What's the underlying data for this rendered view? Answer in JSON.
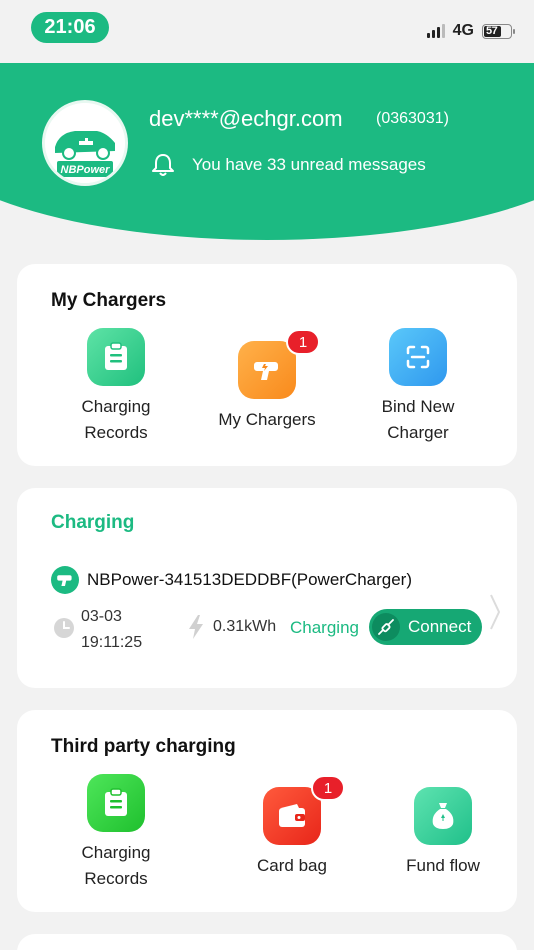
{
  "status_bar": {
    "time": "21:06",
    "network": "4G",
    "battery": "57"
  },
  "profile": {
    "email": "dev****@echgr.com",
    "user_id": "(0363031)",
    "messages": "You have 33 unread messages",
    "logo_text": "NBPower"
  },
  "my_chargers": {
    "title": "My Chargers",
    "items": [
      {
        "label": "Charging Records",
        "icon": "clipboard-icon"
      },
      {
        "label": "My Chargers",
        "icon": "charger-icon",
        "badge": "1"
      },
      {
        "label": "Bind New Charger",
        "icon": "scan-icon"
      }
    ]
  },
  "charging": {
    "title": "Charging",
    "charger_name": "NBPower-341513DEDDBF(PowerCharger)",
    "date": "03-03",
    "time": "19:11:25",
    "energy": "0.31kWh",
    "status": "Charging",
    "connect_label": "Connect"
  },
  "third_party": {
    "title": "Third party charging",
    "items": [
      {
        "label": "Charging Records",
        "icon": "clipboard-icon"
      },
      {
        "label": "Card bag",
        "icon": "wallet-icon",
        "badge": "1"
      },
      {
        "label": "Fund flow",
        "icon": "money-bag-icon"
      }
    ]
  },
  "colors": {
    "brand": "#1cba82",
    "badge": "#e8202a"
  }
}
